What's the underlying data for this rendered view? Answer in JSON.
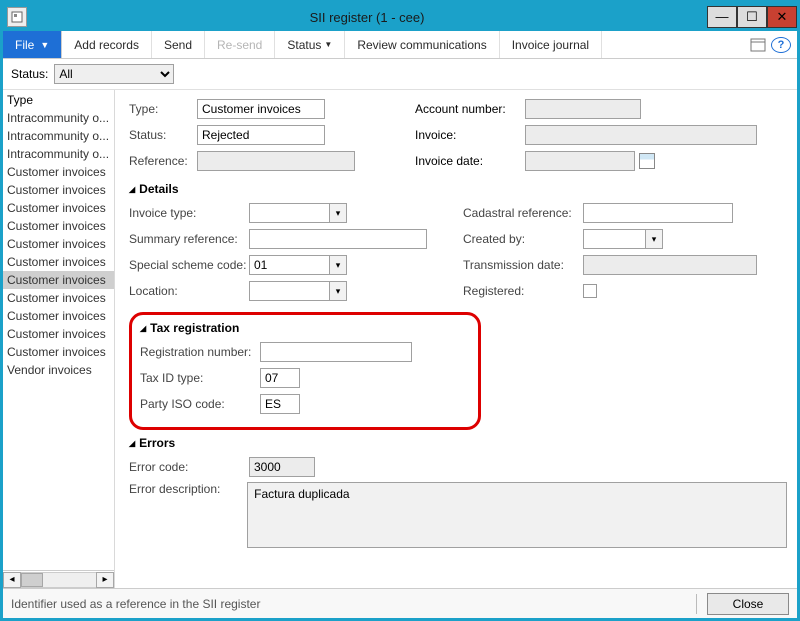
{
  "title": "SII register (1 - cee)",
  "toolbar": {
    "file": "File",
    "add_records": "Add records",
    "send": "Send",
    "resend": "Re-send",
    "status": "Status",
    "review": "Review communications",
    "journal": "Invoice journal"
  },
  "filter": {
    "label": "Status:",
    "value": "All"
  },
  "sidebar": {
    "header": "Type",
    "items": [
      "Intracommunity o...",
      "Intracommunity o...",
      "Intracommunity o...",
      "Customer invoices",
      "Customer invoices",
      "Customer invoices",
      "Customer invoices",
      "Customer invoices",
      "Customer invoices",
      "Customer invoices",
      "Customer invoices",
      "Customer invoices",
      "Customer invoices",
      "Customer invoices",
      "Vendor invoices"
    ]
  },
  "top": {
    "type_label": "Type:",
    "type_value": "Customer invoices",
    "status_label": "Status:",
    "status_value": "Rejected",
    "reference_label": "Reference:",
    "reference_value": "",
    "account_label": "Account number:",
    "account_value": "",
    "invoice_label": "Invoice:",
    "invoice_value": "",
    "invdate_label": "Invoice date:",
    "invdate_value": ""
  },
  "details": {
    "header": "Details",
    "invoice_type_label": "Invoice type:",
    "invoice_type_value": "",
    "summary_ref_label": "Summary reference:",
    "summary_ref_value": "",
    "scheme_label": "Special scheme code:",
    "scheme_value": "01",
    "location_label": "Location:",
    "location_value": "",
    "cadastral_label": "Cadastral reference:",
    "cadastral_value": "",
    "created_label": "Created by:",
    "created_value": "",
    "transdate_label": "Transmission date:",
    "transdate_value": "",
    "registered_label": "Registered:"
  },
  "taxreg": {
    "header": "Tax registration",
    "regnum_label": "Registration number:",
    "regnum_value": "",
    "taxid_label": "Tax ID type:",
    "taxid_value": "07",
    "iso_label": "Party ISO code:",
    "iso_value": "ES"
  },
  "errors": {
    "header": "Errors",
    "code_label": "Error code:",
    "code_value": "3000",
    "desc_label": "Error description:",
    "desc_value": "Factura duplicada"
  },
  "statusbar": {
    "text": "Identifier used as a reference in the SII register",
    "close": "Close"
  }
}
